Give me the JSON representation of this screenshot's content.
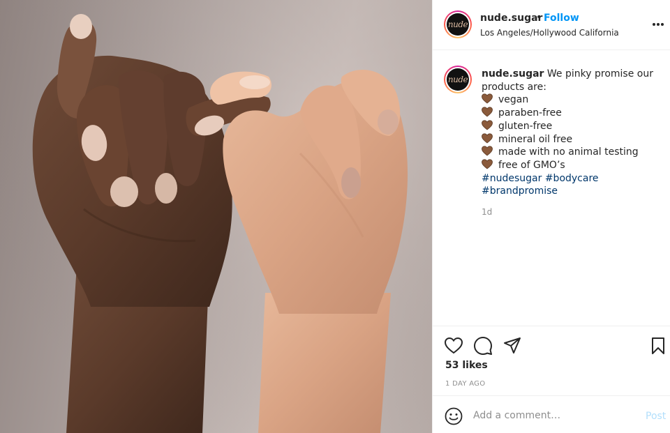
{
  "post": {
    "username": "nude.sugar",
    "separator": "•",
    "follow_label": "Follow",
    "location": "Los Angeles/Hollywood California",
    "avatar_text": "nude",
    "more_icon": "more-options-icon",
    "photo_alt": "Two hands making a pinky promise"
  },
  "caption": {
    "username": "nude.sugar",
    "intro_line1": "We pinky promise our",
    "intro_line2": "products are:",
    "items": [
      "vegan",
      "paraben-free",
      "gluten-free",
      "mineral oil free",
      "made with no animal testing",
      "free of GMO’s"
    ],
    "bullet_icon": "brown-heart-icon",
    "hashtags": [
      "#nudesugar",
      "#bodycare",
      "#brandpromise"
    ],
    "time": "1d"
  },
  "actions": {
    "like_icon": "heart-icon",
    "comment_icon": "comment-icon",
    "share_icon": "share-icon",
    "save_icon": "bookmark-icon",
    "likes": "53 likes",
    "date": "1 DAY AGO"
  },
  "comment_box": {
    "emoji_icon": "emoji-icon",
    "placeholder": "Add a comment…",
    "value": "",
    "post_label": "Post"
  },
  "colors": {
    "accent": "#0095f6",
    "hashtag": "#00376b",
    "muted": "#8e8e8e",
    "post_disabled": "#b2dffc",
    "heart_bullet": "#8a5a3b"
  }
}
